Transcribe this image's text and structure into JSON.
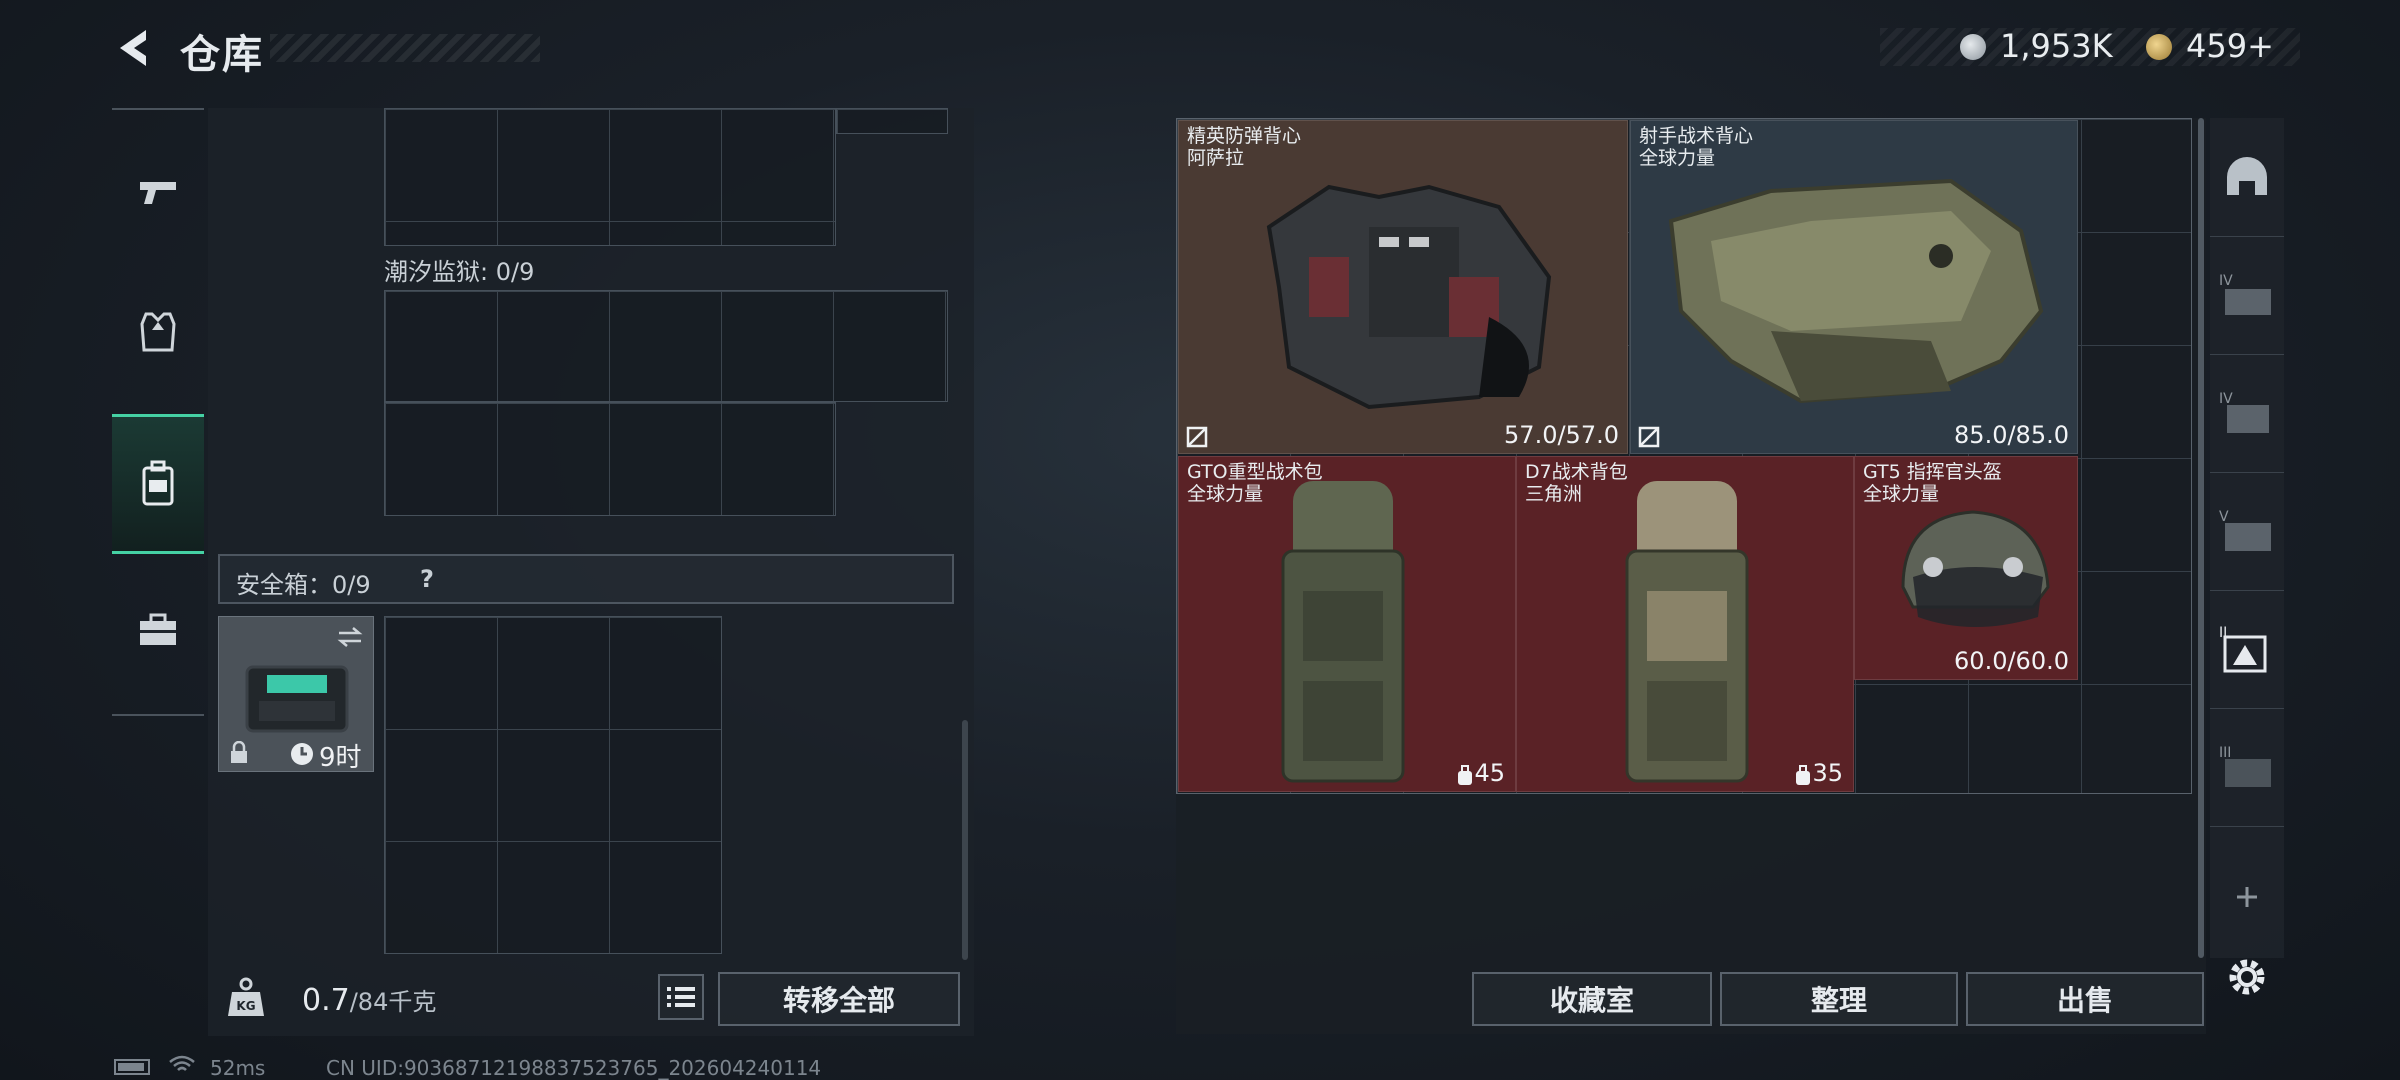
{
  "header": {
    "title": "仓库"
  },
  "currency": [
    {
      "icon": "silver-coin-icon",
      "value": "1,953K",
      "color": "#b8c0c8"
    },
    {
      "icon": "gold-coin-icon",
      "value": "459",
      "suffix": "+",
      "color": "#c7a85c"
    }
  ],
  "left_rail": [
    {
      "icon": "pistol-icon",
      "active": false
    },
    {
      "icon": "armor-vest-icon",
      "active": false
    },
    {
      "icon": "backpack-icon",
      "active": true
    },
    {
      "icon": "toolbox-icon",
      "active": false
    }
  ],
  "containers": {
    "tide_prison": "潮汐监狱: 0/9",
    "safe_box": "安全箱：0/9",
    "safe_help": "?",
    "safe_item_timer": "9时"
  },
  "weight": {
    "current": "0.7",
    "max": "/84千克"
  },
  "buttons": {
    "transfer_all": "转移全部",
    "collection": "收藏室",
    "organize": "整理",
    "sell": "出售"
  },
  "items": [
    {
      "name": "精英防弹背心",
      "subtitle": "阿萨拉",
      "durability": "57.0/57.0",
      "bg": "#4a3a33"
    },
    {
      "name": "射手战术背心",
      "subtitle": "全球力量",
      "durability": "85.0/85.0",
      "bg": "#2e3a45"
    },
    {
      "name": "GTO重型战术包",
      "subtitle": "全球力量",
      "count": "45",
      "bg": "#5a2226"
    },
    {
      "name": "D7战术背包",
      "subtitle": "三角洲",
      "count": "35",
      "bg": "#5a2226"
    },
    {
      "name": "GT5 指挥官头盔",
      "subtitle": "全球力量",
      "durability": "60.0/60.0",
      "bg": "#5a2226"
    }
  ],
  "right_rail": [
    {
      "icon": "helmet-slot-icon",
      "label": ""
    },
    {
      "icon": "armor-tier-iv-icon",
      "label": "IV"
    },
    {
      "icon": "armor-tier-iv-icon",
      "label": "IV"
    },
    {
      "icon": "armor-tier-v-icon",
      "label": "V"
    },
    {
      "icon": "armor-tier-ii-icon",
      "label": "II"
    },
    {
      "icon": "armor-tier-iii-icon",
      "label": "III"
    }
  ],
  "status": {
    "ping": "52ms",
    "uid": "CN UID:9036871219883752376​5_202604240114"
  }
}
